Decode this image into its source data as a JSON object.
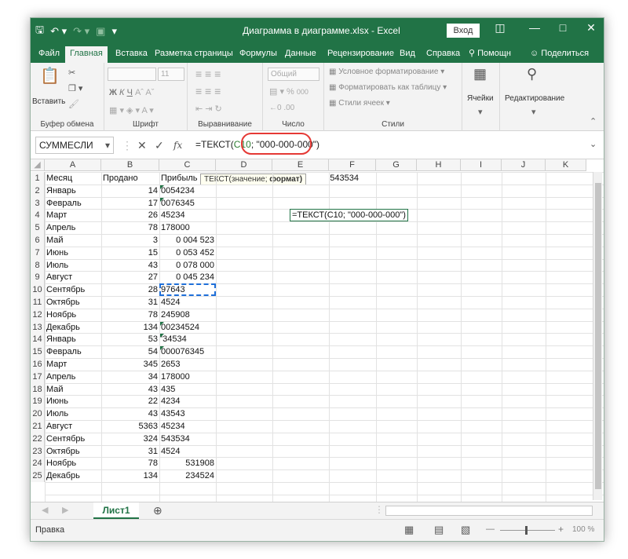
{
  "titlebar": {
    "save_icon": "save-icon",
    "undo_icon": "undo-icon",
    "redo_icon": "redo-icon",
    "title": "Диаграмма в диаграмме.xlsx - Excel",
    "login_label": "Вход"
  },
  "tabs": [
    "Файл",
    "Главная",
    "Вставка",
    "Разметка страницы",
    "Формулы",
    "Данные",
    "Рецензирование",
    "Вид",
    "Справка"
  ],
  "tell_me": "Помощн",
  "share_label": "Поделиться",
  "ribbon": {
    "clipboard": {
      "paste_label": "Вставить",
      "group_label": "Буфер обмена"
    },
    "font": {
      "size": "11",
      "group_label": "Шрифт",
      "bold": "Ж",
      "italic": "К",
      "underline": "Ч"
    },
    "alignment": {
      "group_label": "Выравнивание"
    },
    "number": {
      "format": "Общий",
      "group_label": "Число",
      "percent": "%",
      "thousands": "000"
    },
    "styles": {
      "items": [
        "Условное форматирование",
        "Форматировать как таблицу",
        "Стили ячеек"
      ],
      "group_label": "Стили"
    },
    "cells_label": "Ячейки",
    "editing_label": "Редактирование"
  },
  "formula_bar": {
    "name_box": "СУММЕСЛИ",
    "fx": "fx",
    "formula_prefix": "=ТЕКСТ(",
    "formula_ref": "C10",
    "formula_suffix": "; \"000-000-000\")"
  },
  "tooltip": {
    "fn": "ТЕКСТ(значение;",
    "arg": "формат)"
  },
  "columns": [
    "A",
    "B",
    "C",
    "D",
    "E",
    "F",
    "G",
    "H",
    "I",
    "J",
    "K"
  ],
  "rows": [
    {
      "n": "1",
      "a": "Месяц",
      "b": "Продано",
      "c": "Прибыль",
      "c_align": "left",
      "b_align": "left"
    },
    {
      "n": "2",
      "a": "Январь",
      "b": "14",
      "c": "0054234",
      "c_align": "left"
    },
    {
      "n": "3",
      "a": "Февраль",
      "b": "17",
      "c": "0076345",
      "c_align": "left"
    },
    {
      "n": "4",
      "a": "Март",
      "b": "26",
      "c": "45234",
      "c_align": "left"
    },
    {
      "n": "5",
      "a": "Апрель",
      "b": "78",
      "c": "178000",
      "c_align": "left"
    },
    {
      "n": "6",
      "a": "Май",
      "b": "3",
      "c": "0 004 523",
      "c_align": "right"
    },
    {
      "n": "7",
      "a": "Июнь",
      "b": "15",
      "c": "0 053 452",
      "c_align": "right"
    },
    {
      "n": "8",
      "a": "Июль",
      "b": "43",
      "c": "0 078 000",
      "c_align": "right"
    },
    {
      "n": "9",
      "a": "Август",
      "b": "27",
      "c": "0 045 234",
      "c_align": "right"
    },
    {
      "n": "10",
      "a": "Сентябрь",
      "b": "28",
      "c": "97643",
      "c_align": "left"
    },
    {
      "n": "11",
      "a": "Октябрь",
      "b": "31",
      "c": "4524",
      "c_align": "left"
    },
    {
      "n": "12",
      "a": "Ноябрь",
      "b": "78",
      "c": "245908",
      "c_align": "left"
    },
    {
      "n": "13",
      "a": "Декабрь",
      "b": "134",
      "c": "00234524",
      "c_align": "left"
    },
    {
      "n": "14",
      "a": "Январь",
      "b": "53",
      "c": "'34534",
      "c_align": "left"
    },
    {
      "n": "15",
      "a": "Февраль",
      "b": "54",
      "c": "000076345",
      "c_align": "left"
    },
    {
      "n": "16",
      "a": "Март",
      "b": "345",
      "c": "2653",
      "c_align": "left"
    },
    {
      "n": "17",
      "a": "Апрель",
      "b": "34",
      "c": "178000",
      "c_align": "left"
    },
    {
      "n": "18",
      "a": "Май",
      "b": "43",
      "c": "435",
      "c_align": "left"
    },
    {
      "n": "19",
      "a": "Июнь",
      "b": "22",
      "c": "4234",
      "c_align": "left"
    },
    {
      "n": "20",
      "a": "Июль",
      "b": "43",
      "c": "43543",
      "c_align": "left"
    },
    {
      "n": "21",
      "a": "Август",
      "b": "5363",
      "c": "45234",
      "c_align": "left"
    },
    {
      "n": "22",
      "a": "Сентябрь",
      "b": "324",
      "c": "543534",
      "c_align": "left"
    },
    {
      "n": "23",
      "a": "Октябрь",
      "b": "31",
      "c": "4524",
      "c_align": "left"
    },
    {
      "n": "24",
      "a": "Ноябрь",
      "b": "78",
      "c": "531908",
      "c_align": "right"
    },
    {
      "n": "25",
      "a": "Декабрь",
      "b": "134",
      "c": "234524",
      "c_align": "right"
    }
  ],
  "e1_value": "543534",
  "e4_formula": "=ТЕКСТ(C10; \"000-000-000\")",
  "sheet_tab": "Лист1",
  "status": "Правка",
  "zoom": "100 %",
  "colors": {
    "excel_green": "#217346",
    "highlight_red": "#e53935"
  }
}
